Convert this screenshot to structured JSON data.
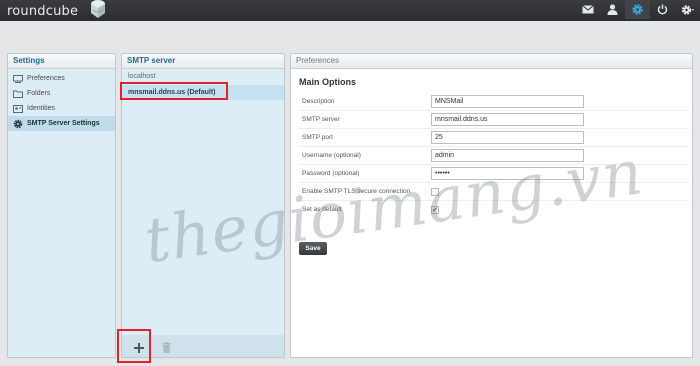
{
  "app": {
    "logo_text": "roundcube"
  },
  "topbar": {
    "icons": [
      "mail-icon",
      "contacts-icon",
      "settings-icon",
      "logout-icon",
      "gear-icon"
    ]
  },
  "settings": {
    "title": "Settings",
    "items": [
      {
        "label": "Preferences",
        "icon": "monitor-icon"
      },
      {
        "label": "Folders",
        "icon": "folder-icon"
      },
      {
        "label": "Identities",
        "icon": "identity-icon"
      },
      {
        "label": "SMTP Server Settings",
        "icon": "gear-icon",
        "selected": true
      }
    ]
  },
  "smtp": {
    "title": "SMTP server",
    "items": [
      {
        "label": "localhost"
      },
      {
        "label": "mnsmail.ddns.us (Default)",
        "selected": true
      }
    ],
    "add_label": "+",
    "delete_icon": "trash-icon"
  },
  "preferences": {
    "title": "Preferences",
    "section": "Main Options",
    "fields": [
      {
        "label": "Description",
        "value": "MNSMail"
      },
      {
        "label": "SMTP server",
        "value": "mnsmail.ddns.us"
      },
      {
        "label": "SMTP port",
        "value": "25"
      },
      {
        "label": "Username (optional)",
        "value": "admin"
      },
      {
        "label": "Password (optional)",
        "value": "••••••"
      }
    ],
    "checks": [
      {
        "label": "Enable SMTP TLS secure connection",
        "checked": false
      },
      {
        "label": "Set as default",
        "checked": true
      }
    ],
    "save_label": "Save"
  },
  "watermark": "thegioimang.vn",
  "colors": {
    "accent": "#1e6a8d",
    "highlight": "#e3202d",
    "active_icon": "#35a9e0"
  }
}
